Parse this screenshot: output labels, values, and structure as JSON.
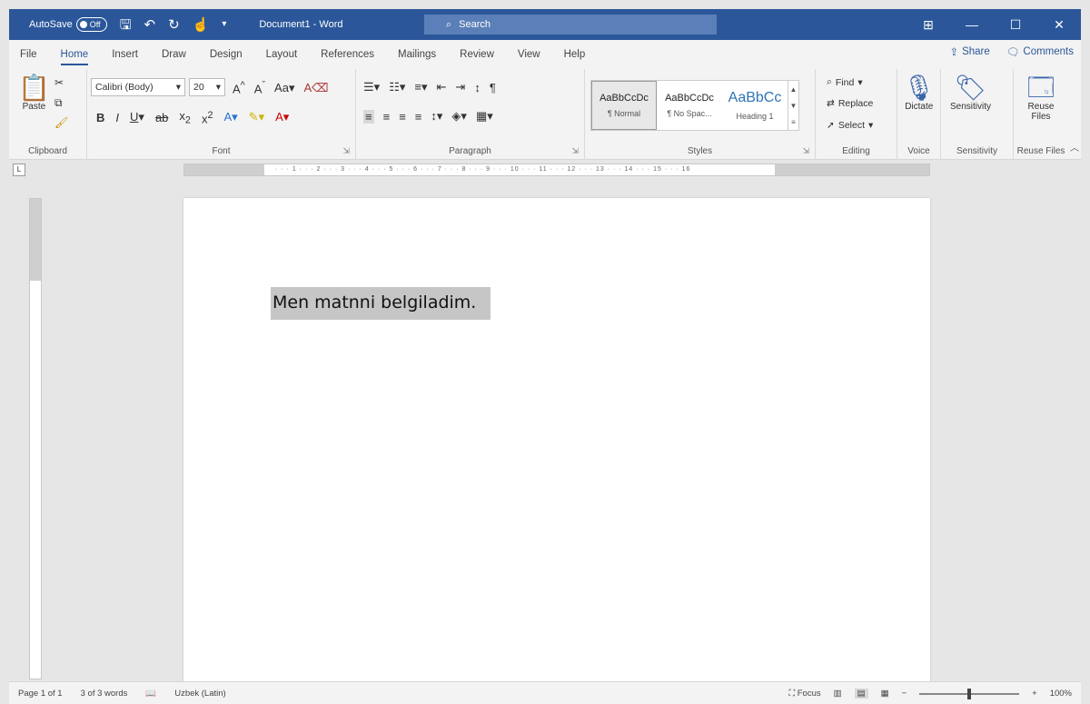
{
  "titlebar": {
    "autosave_label": "AutoSave",
    "autosave_state": "Off",
    "doc_title": "Document1 - Word",
    "search_placeholder": "Search",
    "controls": [
      "⊞",
      "—",
      "☐",
      "✕"
    ]
  },
  "tabs": [
    "File",
    "Home",
    "Insert",
    "Draw",
    "Design",
    "Layout",
    "References",
    "Mailings",
    "Review",
    "View",
    "Help"
  ],
  "active_tab": "Home",
  "share_label": "Share",
  "comments_label": "Comments",
  "ribbon": {
    "clipboard": {
      "paste_label": "Paste",
      "group_label": "Clipboard"
    },
    "font": {
      "font_name": "Calibri (Body)",
      "font_size": "20",
      "group_label": "Font"
    },
    "paragraph": {
      "group_label": "Paragraph"
    },
    "styles": {
      "tiles": [
        {
          "sample": "AaBbCcDc",
          "name": "¶ Normal"
        },
        {
          "sample": "AaBbCcDc",
          "name": "¶ No Spac..."
        },
        {
          "sample": "AaBbCc",
          "name": "Heading 1"
        }
      ],
      "group_label": "Styles"
    },
    "editing": {
      "find": "Find",
      "replace": "Replace",
      "select": "Select",
      "group_label": "Editing"
    },
    "voice": {
      "dictate": "Dictate",
      "group_label": "Voice"
    },
    "sensitivity": {
      "label": "Sensitivity",
      "group_label": "Sensitivity"
    },
    "reuse": {
      "label": "Reuse Files",
      "group_label": "Reuse Files"
    }
  },
  "document": {
    "text": "Men matnni belgiladim."
  },
  "statusbar": {
    "page": "Page 1 of 1",
    "words": "3 of 3 words",
    "language": "Uzbek (Latin)",
    "focus": "Focus",
    "zoom": "100%"
  },
  "colors": {
    "accent": "#2b579a",
    "selection": "#c6c6c6"
  }
}
